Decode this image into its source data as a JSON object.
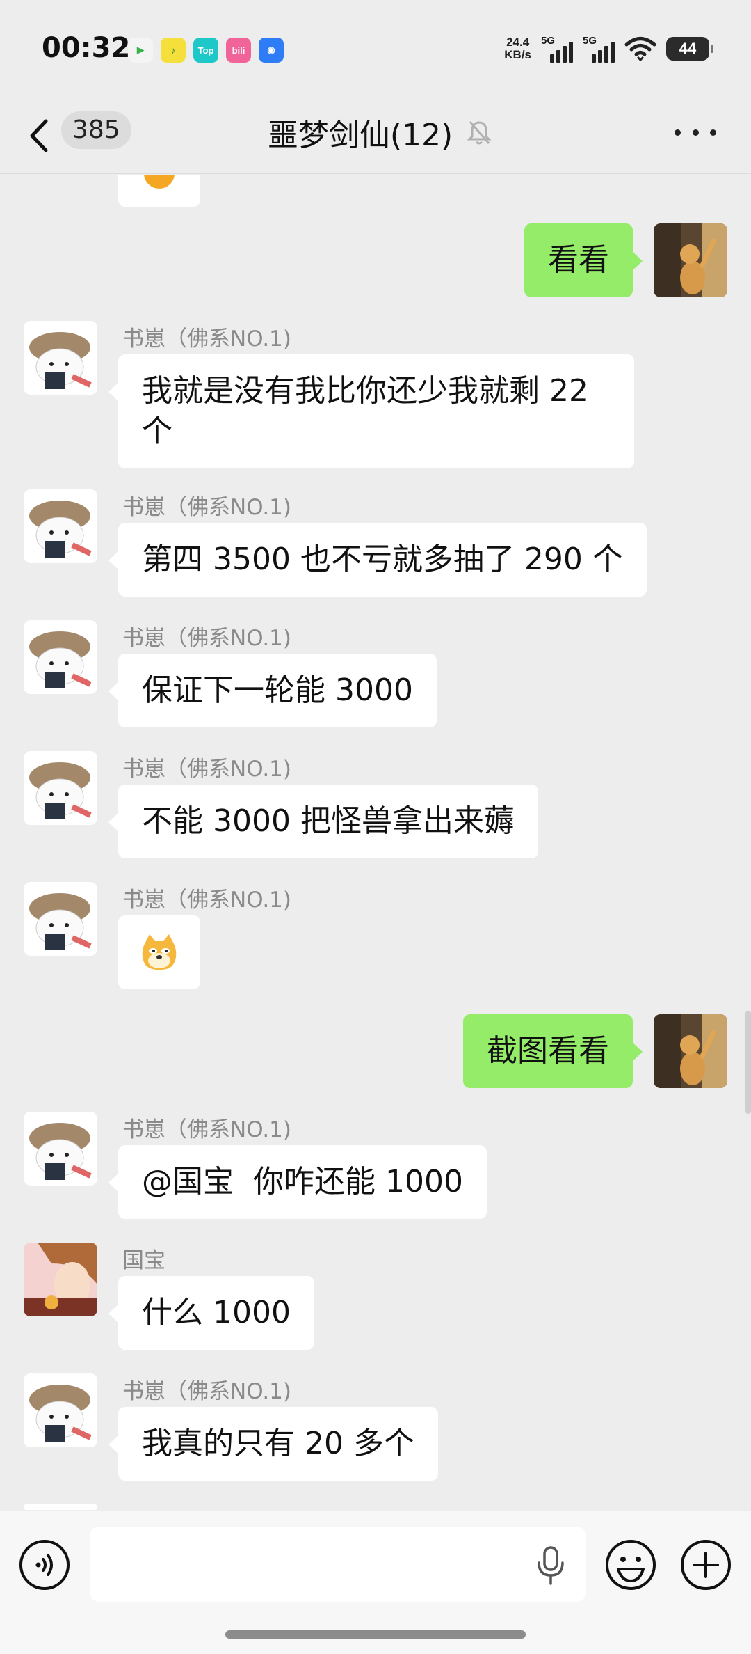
{
  "status_bar": {
    "time": "00:32",
    "app_icons": [
      {
        "name": "video-app-icon",
        "label": "▶",
        "color": "#f4f4f4",
        "fg": "#37b24d"
      },
      {
        "name": "music-app-icon",
        "label": "♪",
        "color": "#f5e03b",
        "fg": "#2e7d32"
      },
      {
        "name": "top-app-icon",
        "label": "Top",
        "color": "#1fc8c8",
        "fg": "#ffffff"
      },
      {
        "name": "bilibili-app-icon",
        "label": "bili",
        "color": "#f0649a",
        "fg": "#ffffff"
      },
      {
        "name": "browser-app-icon",
        "label": "◉",
        "color": "#2f7df6",
        "fg": "#ffffff"
      }
    ],
    "net_speed_value": "24.4",
    "net_speed_unit": "KB/s",
    "signal1_label": "5G",
    "signal2_label": "5G",
    "battery": "44"
  },
  "header": {
    "back_count": "385",
    "title": "噩梦剑仙(12)"
  },
  "messages": [
    {
      "id": "m1",
      "side": "right",
      "text": "看看"
    },
    {
      "id": "m2",
      "side": "left",
      "sender": "书崽（佛系NO.1)",
      "text": "我就是没有我比你还少我就剩 22\n个"
    },
    {
      "id": "m3",
      "side": "left",
      "sender": "书崽（佛系NO.1)",
      "text": "第四 3500 也不亏就多抽了 290 个"
    },
    {
      "id": "m4",
      "side": "left",
      "sender": "书崽（佛系NO.1)",
      "text": "保证下一轮能 3000"
    },
    {
      "id": "m5",
      "side": "left",
      "sender": "书崽（佛系NO.1)",
      "text": "不能 3000 把怪兽拿出来薅"
    },
    {
      "id": "m6",
      "side": "left",
      "sender": "书崽（佛系NO.1)",
      "text": "",
      "emoji": "doge-emoji"
    },
    {
      "id": "m7",
      "side": "right",
      "text": "截图看看"
    },
    {
      "id": "m8",
      "side": "left",
      "sender": "书崽（佛系NO.1)",
      "text": "@国宝  你咋还能 1000"
    },
    {
      "id": "m9",
      "side": "left",
      "sender": "国宝",
      "text": "什么 1000"
    },
    {
      "id": "m10",
      "side": "left",
      "sender": "书崽（佛系NO.1)",
      "text": "我真的只有 20 多个"
    }
  ],
  "input": {
    "value": "",
    "placeholder": ""
  }
}
